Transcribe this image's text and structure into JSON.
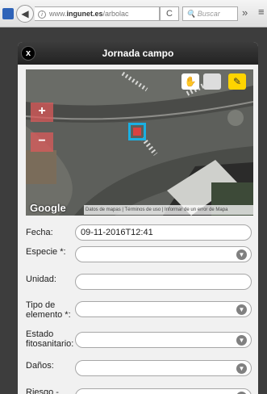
{
  "browser": {
    "url_domain_prefix": "www.",
    "url_domain": "ingunet.es",
    "url_path": "/arbolac",
    "reload_symbol": "C",
    "search_placeholder": "Buscar",
    "overflow_symbol": "»",
    "menu_symbol": "≡"
  },
  "dialog": {
    "title": "Jornada campo",
    "close_symbol": "x"
  },
  "map": {
    "zoom_in": "+",
    "zoom_out": "−",
    "google_logo": "Google",
    "attribution": "Datos de mapas | Términos de uso | Informar de un error de Mapa",
    "marker_color": "#d94141",
    "marker_border": "#1ab0e3",
    "tools": [
      "hand-icon",
      "polygon-icon",
      "pencil-icon"
    ]
  },
  "form": {
    "fields": [
      {
        "label": "Fecha:",
        "value": "09-11-2016T12:41",
        "type": "text"
      },
      {
        "label": "Especie *:",
        "value": "",
        "type": "select"
      },
      {
        "label": "Unidad:",
        "value": "",
        "type": "text"
      },
      {
        "label": "Tipo de elemento *:",
        "value": "",
        "type": "select"
      },
      {
        "label": "Estado fitosanitario:",
        "value": "",
        "type": "select"
      },
      {
        "label": "Daños:",
        "value": "",
        "type": "select"
      },
      {
        "label": "Riesgo -",
        "value": "",
        "type": "select"
      }
    ]
  }
}
